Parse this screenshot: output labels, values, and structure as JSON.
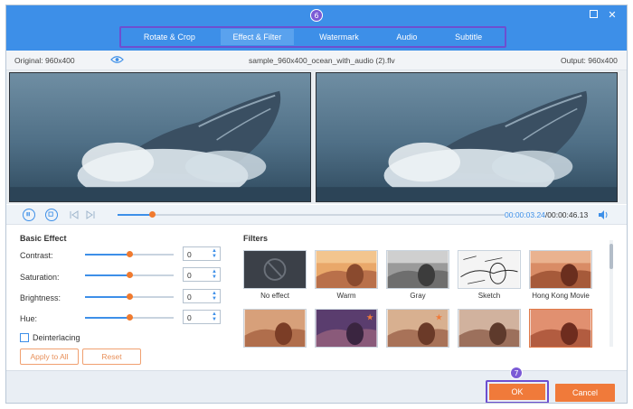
{
  "steps": {
    "tabs_step": "6",
    "ok_step": "7"
  },
  "tabs": [
    {
      "label": "Rotate & Crop"
    },
    {
      "label": "Effect & Filter",
      "active": true
    },
    {
      "label": "Watermark"
    },
    {
      "label": "Audio"
    },
    {
      "label": "Subtitle"
    }
  ],
  "info": {
    "original": "Original: 960x400",
    "filename": "sample_960x400_ocean_with_audio (2).flv",
    "output": "Output: 960x400"
  },
  "playback": {
    "current_time": "00:00:03.24",
    "total_time": "/00:00:46.13",
    "progress_fraction": 0.088
  },
  "basic_effect": {
    "title": "Basic Effect",
    "rows": [
      {
        "label": "Contrast:",
        "value": "0",
        "level": 0.5
      },
      {
        "label": "Saturation:",
        "value": "0",
        "level": 0.5
      },
      {
        "label": "Brightness:",
        "value": "0",
        "level": 0.5
      },
      {
        "label": "Hue:",
        "value": "0",
        "level": 0.5
      }
    ],
    "deinterlacing": "Deinterlacing",
    "apply_all": "Apply to All",
    "reset": "Reset"
  },
  "filters": {
    "title": "Filters",
    "items": [
      {
        "name": "No effect"
      },
      {
        "name": "Warm"
      },
      {
        "name": "Gray"
      },
      {
        "name": "Sketch"
      },
      {
        "name": "Hong Kong Movie"
      },
      {
        "name": ""
      },
      {
        "name": ""
      },
      {
        "name": ""
      },
      {
        "name": ""
      },
      {
        "name": ""
      }
    ]
  },
  "footer": {
    "ok": "OK",
    "cancel": "Cancel"
  },
  "colors": {
    "accent": "#3d8fe8",
    "orange": "#f07a3a",
    "highlight": "#6d4fd0"
  }
}
